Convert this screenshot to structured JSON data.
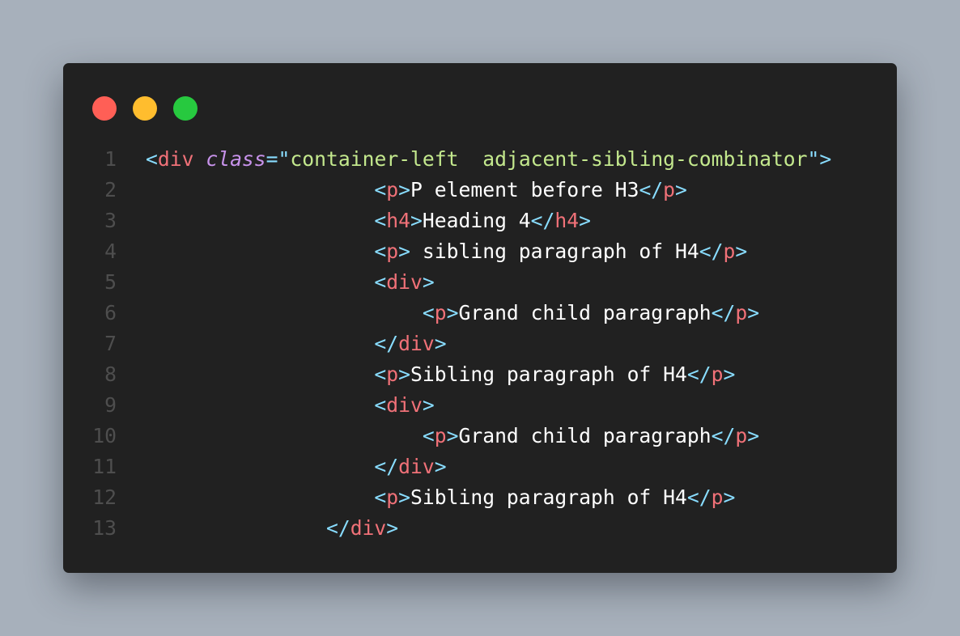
{
  "colors": {
    "punct": "#89ddff",
    "tag": "#f07178",
    "attr": "#c792ea",
    "string": "#c3e88d",
    "text": "#ffffff",
    "line_number": "#4e4e4e",
    "window_bg": "#212121",
    "page_bg": "#a7b0bb"
  },
  "window_controls": [
    {
      "name": "close-dot",
      "color": "#ff5f56"
    },
    {
      "name": "minimize-dot",
      "color": "#ffbd2e"
    },
    {
      "name": "maximize-dot",
      "color": "#27c93f"
    }
  ],
  "lines": [
    {
      "number": "1",
      "indent": "",
      "tokens": [
        {
          "text": "<",
          "kind": "punct"
        },
        {
          "text": "div",
          "kind": "tag"
        },
        {
          "text": " ",
          "kind": "text"
        },
        {
          "text": "class",
          "kind": "attr"
        },
        {
          "text": "=",
          "kind": "punct"
        },
        {
          "text": "\"",
          "kind": "punct"
        },
        {
          "text": "container-left  adjacent-sibling-combinator",
          "kind": "string"
        },
        {
          "text": "\"",
          "kind": "punct"
        },
        {
          "text": ">",
          "kind": "punct"
        }
      ]
    },
    {
      "number": "2",
      "indent": "                   ",
      "tokens": [
        {
          "text": "<",
          "kind": "punct"
        },
        {
          "text": "p",
          "kind": "tag"
        },
        {
          "text": ">",
          "kind": "punct"
        },
        {
          "text": "P element before H3",
          "kind": "text"
        },
        {
          "text": "</",
          "kind": "punct"
        },
        {
          "text": "p",
          "kind": "tag"
        },
        {
          "text": ">",
          "kind": "punct"
        }
      ]
    },
    {
      "number": "3",
      "indent": "                   ",
      "tokens": [
        {
          "text": "<",
          "kind": "punct"
        },
        {
          "text": "h4",
          "kind": "tag"
        },
        {
          "text": ">",
          "kind": "punct"
        },
        {
          "text": "Heading 4",
          "kind": "text"
        },
        {
          "text": "</",
          "kind": "punct"
        },
        {
          "text": "h4",
          "kind": "tag"
        },
        {
          "text": ">",
          "kind": "punct"
        }
      ]
    },
    {
      "number": "4",
      "indent": "                   ",
      "tokens": [
        {
          "text": "<",
          "kind": "punct"
        },
        {
          "text": "p",
          "kind": "tag"
        },
        {
          "text": ">",
          "kind": "punct"
        },
        {
          "text": " sibling paragraph of H4",
          "kind": "text"
        },
        {
          "text": "</",
          "kind": "punct"
        },
        {
          "text": "p",
          "kind": "tag"
        },
        {
          "text": ">",
          "kind": "punct"
        }
      ]
    },
    {
      "number": "5",
      "indent": "                   ",
      "tokens": [
        {
          "text": "<",
          "kind": "punct"
        },
        {
          "text": "div",
          "kind": "tag"
        },
        {
          "text": ">",
          "kind": "punct"
        }
      ]
    },
    {
      "number": "6",
      "indent": "                       ",
      "tokens": [
        {
          "text": "<",
          "kind": "punct"
        },
        {
          "text": "p",
          "kind": "tag"
        },
        {
          "text": ">",
          "kind": "punct"
        },
        {
          "text": "Grand child paragraph",
          "kind": "text"
        },
        {
          "text": "</",
          "kind": "punct"
        },
        {
          "text": "p",
          "kind": "tag"
        },
        {
          "text": ">",
          "kind": "punct"
        }
      ]
    },
    {
      "number": "7",
      "indent": "                   ",
      "tokens": [
        {
          "text": "</",
          "kind": "punct"
        },
        {
          "text": "div",
          "kind": "tag"
        },
        {
          "text": ">",
          "kind": "punct"
        }
      ]
    },
    {
      "number": "8",
      "indent": "                   ",
      "tokens": [
        {
          "text": "<",
          "kind": "punct"
        },
        {
          "text": "p",
          "kind": "tag"
        },
        {
          "text": ">",
          "kind": "punct"
        },
        {
          "text": "Sibling paragraph of H4",
          "kind": "text"
        },
        {
          "text": "</",
          "kind": "punct"
        },
        {
          "text": "p",
          "kind": "tag"
        },
        {
          "text": ">",
          "kind": "punct"
        }
      ]
    },
    {
      "number": "9",
      "indent": "                   ",
      "tokens": [
        {
          "text": "<",
          "kind": "punct"
        },
        {
          "text": "div",
          "kind": "tag"
        },
        {
          "text": ">",
          "kind": "punct"
        }
      ]
    },
    {
      "number": "10",
      "indent": "                       ",
      "tokens": [
        {
          "text": "<",
          "kind": "punct"
        },
        {
          "text": "p",
          "kind": "tag"
        },
        {
          "text": ">",
          "kind": "punct"
        },
        {
          "text": "Grand child paragraph",
          "kind": "text"
        },
        {
          "text": "</",
          "kind": "punct"
        },
        {
          "text": "p",
          "kind": "tag"
        },
        {
          "text": ">",
          "kind": "punct"
        }
      ]
    },
    {
      "number": "11",
      "indent": "                   ",
      "tokens": [
        {
          "text": "</",
          "kind": "punct"
        },
        {
          "text": "div",
          "kind": "tag"
        },
        {
          "text": ">",
          "kind": "punct"
        }
      ]
    },
    {
      "number": "12",
      "indent": "                   ",
      "tokens": [
        {
          "text": "<",
          "kind": "punct"
        },
        {
          "text": "p",
          "kind": "tag"
        },
        {
          "text": ">",
          "kind": "punct"
        },
        {
          "text": "Sibling paragraph of H4",
          "kind": "text"
        },
        {
          "text": "</",
          "kind": "punct"
        },
        {
          "text": "p",
          "kind": "tag"
        },
        {
          "text": ">",
          "kind": "punct"
        }
      ]
    },
    {
      "number": "13",
      "indent": "               ",
      "tokens": [
        {
          "text": "</",
          "kind": "punct"
        },
        {
          "text": "div",
          "kind": "tag"
        },
        {
          "text": ">",
          "kind": "punct"
        }
      ]
    }
  ]
}
